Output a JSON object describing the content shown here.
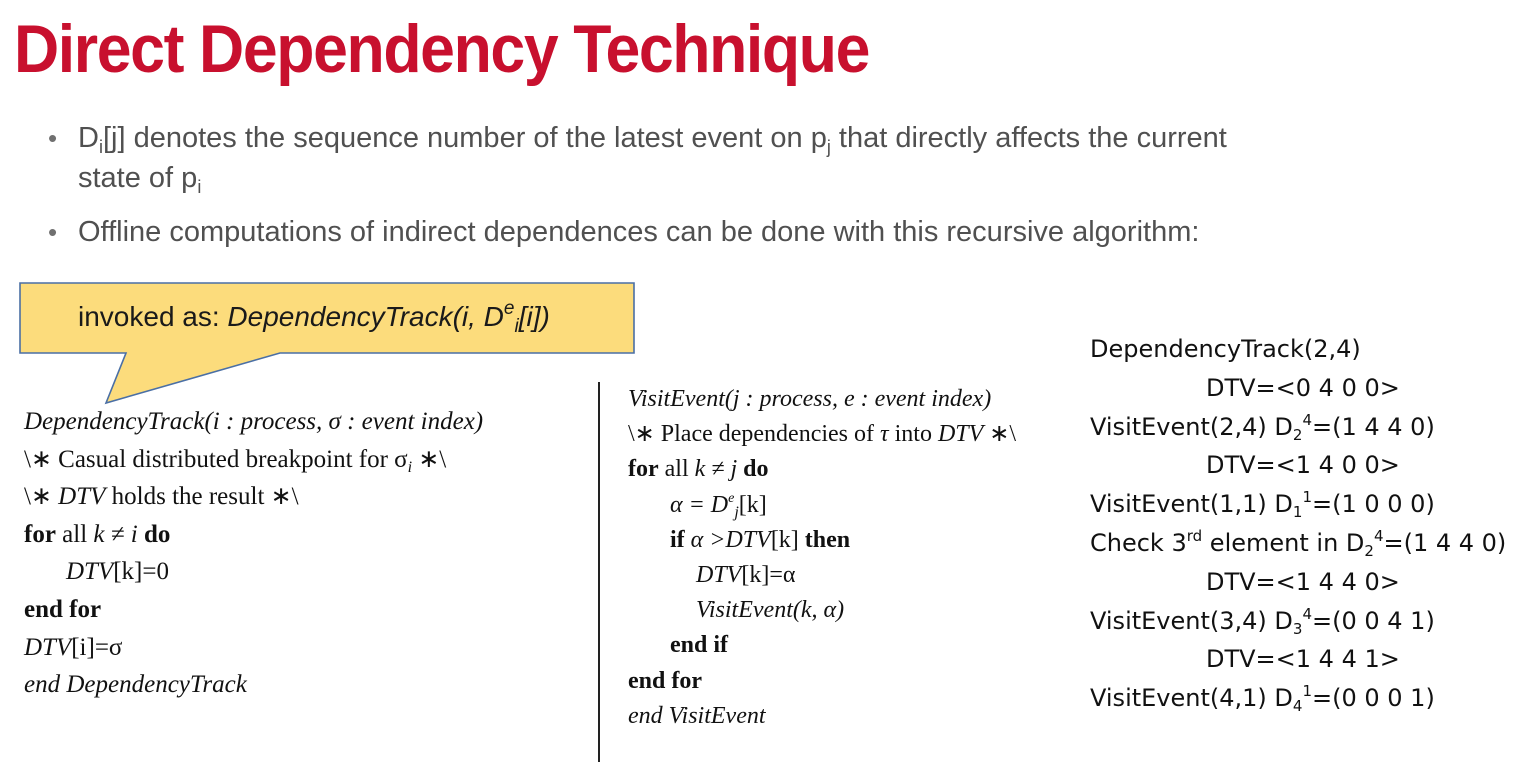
{
  "slide": {
    "title": "Direct Dependency Technique"
  },
  "bullets": {
    "b1_d": "D",
    "b1_d_sub": "i",
    "b1_a": "[j] denotes the sequence number of the latest event on p",
    "b1_p_sub": "j",
    "b1_b": " that directly affects the current",
    "b1_c": "state of p",
    "b1_c_sub": "i",
    "b2": "Offline computations of indirect dependences can be done with this recursive algorithm:",
    "marker": "•"
  },
  "callout": {
    "prefix": "invoked as: ",
    "func": "DependencyTrack",
    "open": "(i, D",
    "sup": "e",
    "sub": "i",
    "close": "[i])",
    "fill_color": "#fcdc7c",
    "border_color": "#4a6fa5"
  },
  "algo1": {
    "l1_name": "DependencyTrack",
    "l1_rest": "(i : process, σ : event index)",
    "l2_a": "\\∗ Casual distributed breakpoint for σ",
    "l2_sub": "i",
    "l2_b": " ∗\\",
    "l3_a": "\\∗ ",
    "l3_dtv": "DTV",
    "l3_b": " holds the result ∗\\",
    "l4_for": "for",
    "l4_all": " all ",
    "l4_cond": "k ≠ i",
    "l4_do": " do",
    "l5_dtv": "DTV",
    "l5_rest": "[k]=0",
    "l6": "end for",
    "l7_dtv": "DTV",
    "l7_rest": "[i]=σ",
    "l8": "end DependencyTrack"
  },
  "algo2": {
    "l1_name": "VisitEvent",
    "l1_rest": "(j : process, e : event index)",
    "l2_a": "\\∗ Place dependencies of ",
    "l2_tau": "τ",
    "l2_b": " into ",
    "l2_dtv": "DTV",
    "l2_c": " ∗\\",
    "l3_for": "for",
    "l3_all": " all ",
    "l3_cond": "k ≠ j",
    "l3_do": " do",
    "l4_a": "α = D",
    "l4_sup": "e",
    "l4_sub": "j",
    "l4_b": "[k]",
    "l5_if": "if",
    "l5_a": " α >",
    "l5_dtv": "DTV",
    "l5_b": "[k]",
    "l5_then": " then",
    "l6_dtv": "DTV",
    "l6_rest": "[k]=α",
    "l7": "VisitEvent(k, α)",
    "l8": "end if",
    "l9": "end for",
    "l10": "end VisitEvent"
  },
  "trace": {
    "t1": "DependencyTrack(2,4)",
    "t2": "DTV=<0 4 0 0>",
    "t3_a": "VisitEvent(2,4)  D",
    "t3_sub": "2",
    "t3_sup": "4",
    "t3_b": "=(1 4 4 0)",
    "t4": "DTV=<1 4 0 0>",
    "t5_a": "VisitEvent(1,1) D",
    "t5_sub": "1",
    "t5_sup": "1",
    "t5_b": "=(1 0 0 0)",
    "t6_a": "Check 3",
    "t6_sup": "rd",
    "t6_b": " element in D",
    "t6_sub": "2",
    "t6_sup2": "4",
    "t6_c": "=(1 4 4 0)",
    "t7": "DTV=<1 4 4 0>",
    "t8_a": "VisitEvent(3,4) D",
    "t8_sub": "3",
    "t8_sup": "4",
    "t8_b": "=(0 0 4 1)",
    "t9": "DTV=<1 4 4 1>",
    "t10_a": "VisitEvent(4,1) D",
    "t10_sub": "4",
    "t10_sup": "1",
    "t10_b": "=(0 0 0 1)"
  },
  "colors": {
    "title": "#c8102e",
    "bullet_text": "#505050"
  }
}
